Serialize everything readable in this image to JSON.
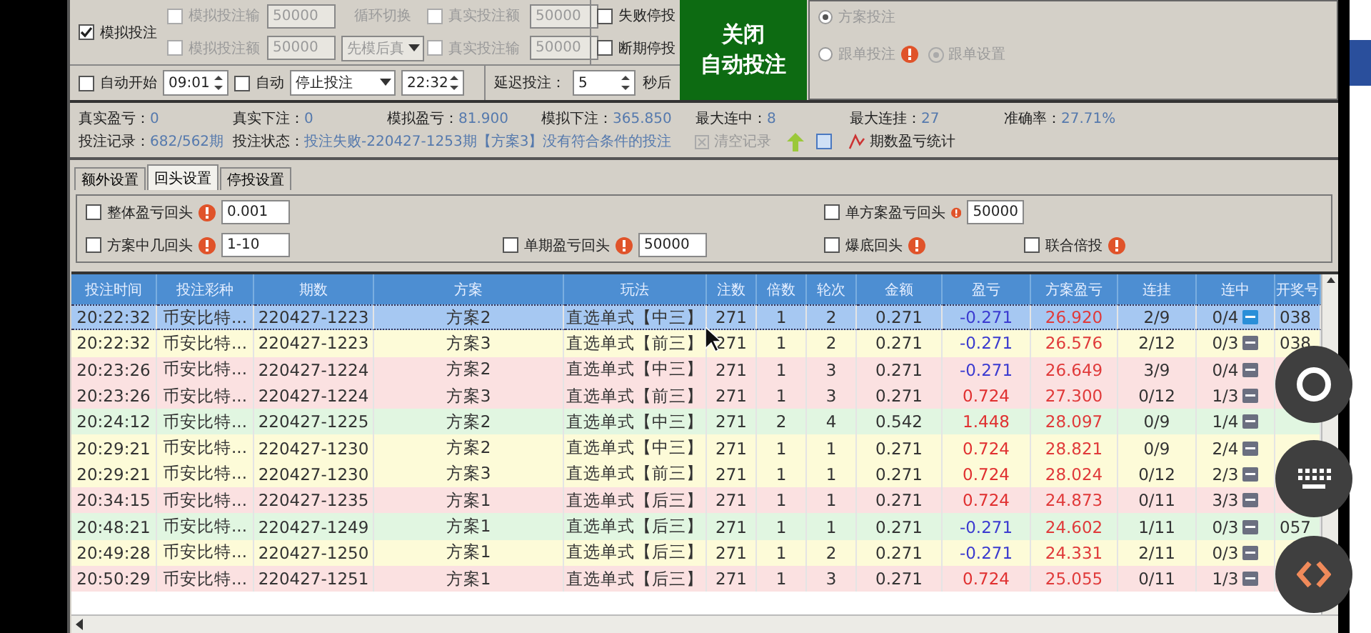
{
  "simulate": {
    "label": "模拟投注",
    "checked": true
  },
  "bet_limits": [
    {
      "label": "模拟投注输",
      "checked": false,
      "disabled": true,
      "value": "50000"
    },
    {
      "label": "真实投注额",
      "checked": false,
      "disabled": true,
      "value": "50000"
    },
    {
      "label": "模拟投注额",
      "checked": false,
      "disabled": true,
      "value": "50000"
    },
    {
      "label": "真实投注输",
      "checked": false,
      "disabled": true,
      "value": "50000"
    }
  ],
  "cycle_switch": {
    "label": "循环切换",
    "mode": "先模后真"
  },
  "stop_options": [
    {
      "label": "失败停投",
      "checked": false
    },
    {
      "label": "断期停投",
      "checked": false
    }
  ],
  "toggle_button": [
    "关闭",
    "自动投注"
  ],
  "modes": [
    {
      "label": "方案投注",
      "selected": true
    },
    {
      "label": "跟单投注",
      "selected": false
    }
  ],
  "follow_settings": "跟单设置",
  "schedule": {
    "auto_start": {
      "label": "自动开始",
      "checked": false,
      "time": "09:01"
    },
    "auto": {
      "label": "自动",
      "checked": false,
      "action": "停止投注",
      "time": "22:32"
    },
    "delay": {
      "label": "延迟投注：",
      "value": "5",
      "unit": "秒后"
    }
  },
  "stats": [
    {
      "label": "真实盈亏：",
      "value": "0"
    },
    {
      "label": "真实下注：",
      "value": "0"
    },
    {
      "label": "模拟盈亏：",
      "value": "81.900"
    },
    {
      "label": "模拟下注：",
      "value": "365.850"
    },
    {
      "label": "最大连中：",
      "value": "8"
    },
    {
      "label": "最大连挂：",
      "value": "27"
    },
    {
      "label": "准确率：",
      "value": "27.71%"
    }
  ],
  "record": {
    "label": "投注记录：",
    "value": "682/562期"
  },
  "status": {
    "label": "投注状态：",
    "value": "投注失败-220427-1253期【方案3】没有符合条件的投注"
  },
  "clear_button": {
    "label": "清空记录",
    "disabled": true
  },
  "stats_button": "期数盈亏统计",
  "tabs": [
    {
      "label": "额外设置",
      "selected": false
    },
    {
      "label": "回头设置",
      "selected": true
    },
    {
      "label": "停投设置",
      "selected": false
    }
  ],
  "settings": [
    {
      "label": "整体盈亏回头",
      "checked": false,
      "value": "0.001"
    },
    {
      "label": "单方案盈亏回头",
      "checked": false,
      "value": "50000"
    },
    {
      "label": "方案中几回头",
      "checked": false,
      "value": "1-10"
    },
    {
      "label": "单期盈亏回头",
      "checked": false,
      "value": "50000"
    },
    {
      "label": "爆底回头",
      "checked": false
    },
    {
      "label": "联合倍投",
      "checked": false
    }
  ],
  "table": {
    "columns": [
      "投注时间",
      "投注彩种",
      "期数",
      "方案",
      "玩法",
      "注数",
      "倍数",
      "轮次",
      "金额",
      "盈亏",
      "方案盈亏",
      "连挂",
      "连中",
      "开奖号"
    ],
    "rows": [
      {
        "selected": true,
        "color": "#a6c8f2",
        "cells": [
          "20:22:32",
          "币安比特...",
          "220427-1223",
          "方案2",
          "直选单式【中三】",
          "271",
          "1",
          "2",
          "0.271",
          "-0.271",
          "26.920",
          "2/9",
          "0/4",
          "038"
        ]
      },
      {
        "selected": false,
        "color": "#fdfbd8",
        "cells": [
          "20:22:32",
          "币安比特...",
          "220427-1223",
          "方案3",
          "直选单式【前三】",
          "271",
          "1",
          "2",
          "0.271",
          "-0.271",
          "26.576",
          "2/12",
          "0/3",
          "038"
        ]
      },
      {
        "selected": false,
        "color": "#fbe1e1",
        "cells": [
          "20:23:26",
          "币安比特...",
          "220427-1224",
          "方案2",
          "直选单式【中三】",
          "271",
          "1",
          "3",
          "0.271",
          "-0.271",
          "26.649",
          "3/9",
          "0/4"
        ]
      },
      {
        "selected": false,
        "color": "#fbe1e1",
        "cells": [
          "20:23:26",
          "币安比特...",
          "220427-1224",
          "方案3",
          "直选单式【前三】",
          "271",
          "1",
          "3",
          "0.271",
          "0.724",
          "27.300",
          "0/12",
          "1/3"
        ]
      },
      {
        "selected": false,
        "color": "#e1f6e1",
        "cells": [
          "20:24:12",
          "币安比特...",
          "220427-1225",
          "方案2",
          "直选单式【中三】",
          "271",
          "2",
          "4",
          "0.542",
          "1.448",
          "28.097",
          "0/9",
          "1/4"
        ]
      },
      {
        "selected": false,
        "color": "#fdfbd8",
        "cells": [
          "20:29:21",
          "币安比特...",
          "220427-1230",
          "方案2",
          "直选单式【中三】",
          "271",
          "1",
          "1",
          "0.271",
          "0.724",
          "28.821",
          "0/9",
          "2/4"
        ]
      },
      {
        "selected": false,
        "color": "#fdfbd8",
        "cells": [
          "20:29:21",
          "币安比特...",
          "220427-1230",
          "方案3",
          "直选单式【前三】",
          "271",
          "1",
          "1",
          "0.271",
          "0.724",
          "28.024",
          "0/12",
          "2/3"
        ]
      },
      {
        "selected": false,
        "color": "#fbe1e1",
        "cells": [
          "20:34:15",
          "币安比特...",
          "220427-1235",
          "方案1",
          "直选单式【后三】",
          "271",
          "1",
          "1",
          "0.271",
          "0.724",
          "24.873",
          "0/11",
          "3/3"
        ]
      },
      {
        "selected": false,
        "color": "#e1f6e1",
        "cells": [
          "20:48:21",
          "币安比特...",
          "220427-1249",
          "方案1",
          "直选单式【后三】",
          "271",
          "1",
          "1",
          "0.271",
          "-0.271",
          "24.602",
          "1/11",
          "0/3",
          "057"
        ]
      },
      {
        "selected": false,
        "color": "#fdfbd8",
        "cells": [
          "20:49:28",
          "币安比特...",
          "220427-1250",
          "方案1",
          "直选单式【后三】",
          "271",
          "1",
          "2",
          "0.271",
          "-0.271",
          "24.331",
          "2/11",
          "0/3"
        ]
      },
      {
        "selected": false,
        "color": "#fbe1e1",
        "cells": [
          "20:50:29",
          "币安比特...",
          "220427-1251",
          "方案1",
          "直选单式【后三】",
          "271",
          "1",
          "3",
          "0.271",
          "0.724",
          "25.055",
          "0/11",
          "1/3"
        ]
      }
    ]
  }
}
